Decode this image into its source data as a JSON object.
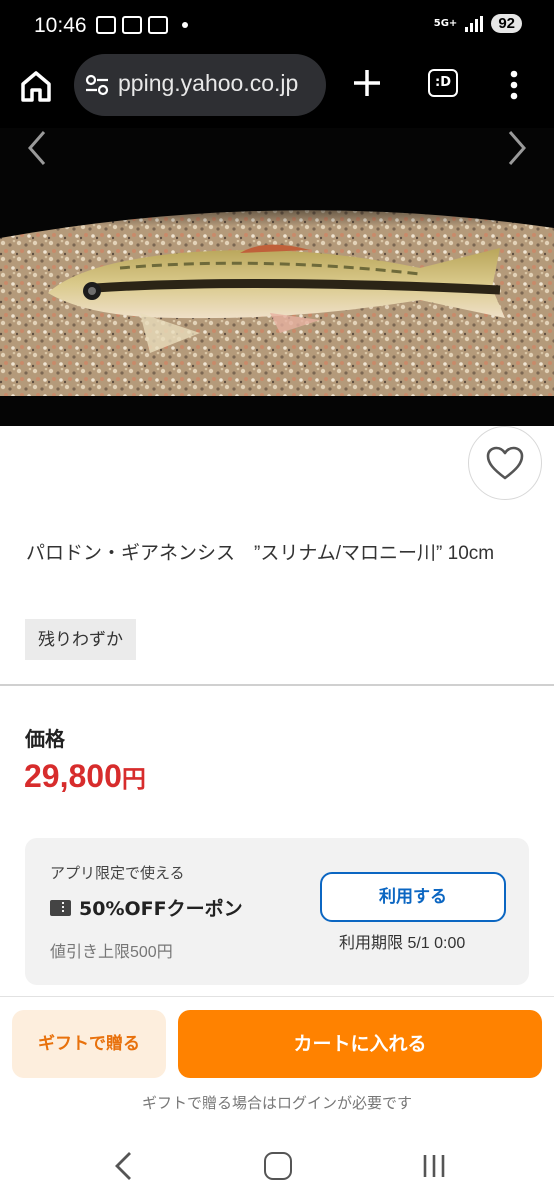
{
  "status_bar": {
    "time": "10:46",
    "network": "5G+",
    "battery": "92"
  },
  "browser": {
    "url": "pping.yahoo.co.jp",
    "tab_label": ":D",
    "icons": [
      "home-icon",
      "tune-icon",
      "plus-icon",
      "tabs-icon",
      "more-vert-icon"
    ]
  },
  "product": {
    "title": "パロドン・ギアネンシス　”スリナム/マロニー川” 10cm",
    "stock_tag": "残りわずか",
    "price_label": "価格",
    "price": "29,800",
    "price_unit": "円"
  },
  "coupon": {
    "note": "アプリ限定で使える",
    "title": "50%OFFクーポン",
    "limit": "値引き上限500円",
    "button": "利用する",
    "expiry": "利用期限 5/1 0:00"
  },
  "actions": {
    "gift_button": "ギフトで贈る",
    "cart_button": "カートに入れる",
    "gift_note": "ギフトで贈る場合はログインが必要です"
  },
  "colors": {
    "price": "#d72c2c",
    "cart": "#ff8200",
    "gift_bg": "#fdeedd",
    "link_blue": "#0b66c2"
  }
}
